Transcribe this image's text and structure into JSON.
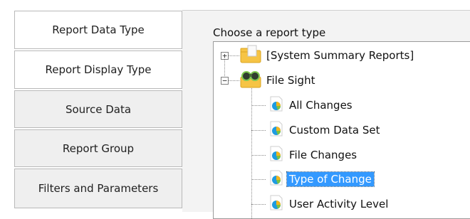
{
  "tabs": [
    {
      "label": "Report Data Type"
    },
    {
      "label": "Report Display Type"
    },
    {
      "label": "Source Data"
    },
    {
      "label": "Report Group"
    },
    {
      "label": "Filters and Parameters"
    }
  ],
  "pane": {
    "label": "Choose a report type",
    "tree": {
      "root1": {
        "label": "[System Summary Reports]",
        "expander": "+",
        "icon": "folder-document-icon"
      },
      "root2": {
        "label": "File Sight",
        "expander": "−",
        "icon": "binoculars-folder-icon"
      },
      "children": [
        {
          "label": "All Changes"
        },
        {
          "label": "Custom Data Set"
        },
        {
          "label": "File Changes"
        },
        {
          "label": "Type of Change"
        },
        {
          "label": "User Activity Level"
        }
      ],
      "selected_index": 3
    }
  },
  "colors": {
    "selection": "#3399ff",
    "tab_bg": "#efefef",
    "pane_bg": "#f3f3f3"
  }
}
